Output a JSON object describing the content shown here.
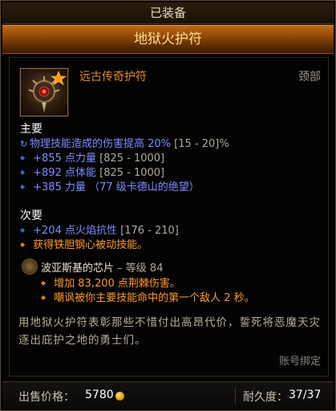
{
  "header": {
    "equipped_label": "已装备",
    "item_name": "地狱火护符"
  },
  "item": {
    "type": "远古传奇护符",
    "slot": "颈部",
    "icon": "amulet-icon",
    "legendary_star": "star-icon"
  },
  "primary": {
    "heading": "主要",
    "stats": [
      {
        "text": "物理技能造成的伤害提高 20%",
        "range": "[15 - 20]%"
      },
      {
        "text": "+855 点力量",
        "range": "[825 - 1000]"
      },
      {
        "text": "+892 点体能",
        "range": "[825 - 1000]"
      },
      {
        "text": "+385 力量",
        "range": "（77 级卡德山的绝望）"
      }
    ]
  },
  "secondary": {
    "heading": "次要",
    "stats": [
      {
        "text": "+204 点火焰抗性",
        "range": "[176 - 210]"
      },
      {
        "text": "获得铁胆钢心被动技能。",
        "range": ""
      }
    ]
  },
  "gem": {
    "icon": "gem-icon",
    "name": "波亚斯基的芯片",
    "rank": "– 等级 84",
    "effects": [
      "增加 83,200 点荆棘伤害。",
      "嘲讽被你主要技能命中的第一个敌人 2 秒。"
    ]
  },
  "flavor_text": "用地狱火护符表彰那些不惜付出高昂代价，誓死将恶魔天灾逐出庇护之地的勇士们。",
  "account_bound": "账号绑定",
  "footer": {
    "sell_label": "出售价格：",
    "sell_value": "5780",
    "coin_icon": "gold-coin-icon",
    "durability_label": "耐久度：",
    "durability_value": "37/37"
  },
  "colors": {
    "legendary_orange": "#e58a2a",
    "affix_blue": "#7f8cff",
    "banner": "#c06a10"
  }
}
